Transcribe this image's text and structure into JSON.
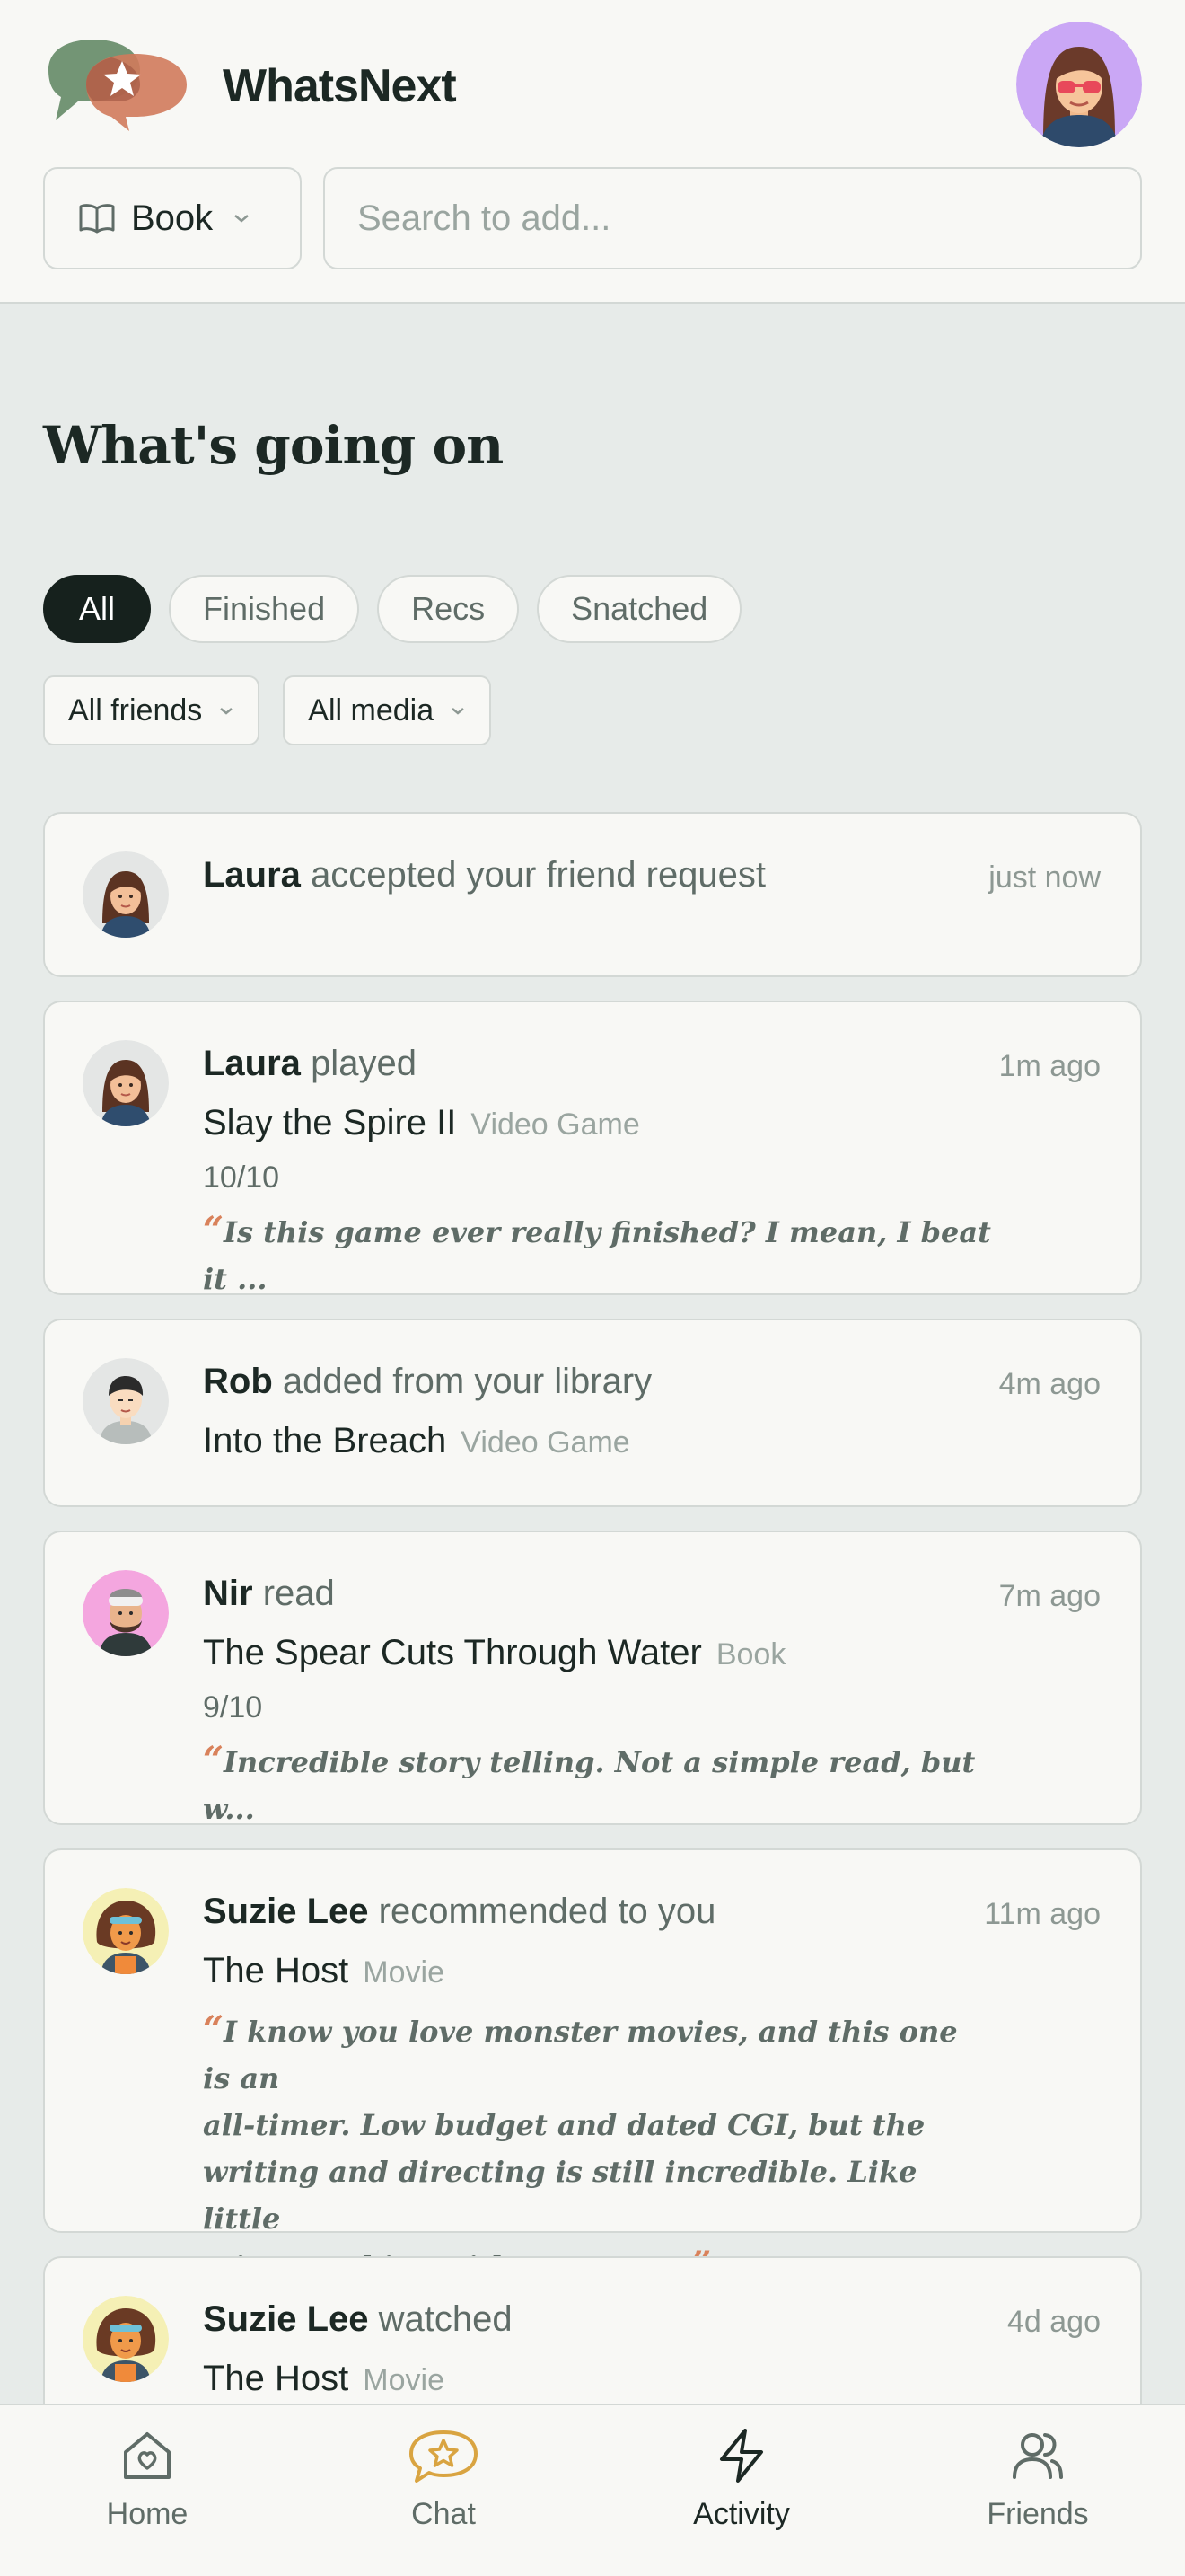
{
  "app": {
    "title": "WhatsNext"
  },
  "toolbar": {
    "media_type": "Book",
    "search_placeholder": "Search to add..."
  },
  "activity": {
    "heading": "What's going on",
    "tabs": [
      "All",
      "Finished",
      "Recs",
      "Snatched"
    ],
    "active_tab": "All",
    "filters": {
      "friends": "All friends",
      "media": "All media"
    }
  },
  "feed": [
    {
      "name": "Laura",
      "action": "accepted your friend request",
      "time": "just now"
    },
    {
      "name": "Laura",
      "action": "played",
      "time": "1m ago",
      "title": "Slay the Spire II",
      "type": "Video Game",
      "rating": "10/10",
      "quote": "Is this game ever really finished? I mean, I beat it ..."
    },
    {
      "name": "Rob",
      "action": "added from your library",
      "time": "4m ago",
      "title": "Into the Breach",
      "type": "Video Game"
    },
    {
      "name": "Nir",
      "action": "read",
      "time": "7m ago",
      "title": "The Spear Cuts Through Water",
      "type": "Book",
      "rating": "9/10",
      "quote": "Incredible story telling. Not a simple read, but w..."
    },
    {
      "name": "Suzie Lee",
      "action": "recommended to you",
      "time": "11m ago",
      "title": "The Host",
      "type": "Movie",
      "quote_lines": [
        "I know you love monster movies, and this one is an",
        "all-timer. Low budget and dated CGI, but the",
        "writing and directing is still incredible. Like little",
        "miss sunshine with a monster."
      ]
    },
    {
      "name": "Suzie Lee",
      "action": "watched",
      "time": "4d ago",
      "title": "The Host",
      "type": "Movie"
    }
  ],
  "nav": [
    {
      "label": "Home",
      "icon": "home-icon"
    },
    {
      "label": "Chat",
      "icon": "chat-star-icon"
    },
    {
      "label": "Activity",
      "icon": "lightning-icon"
    },
    {
      "label": "Friends",
      "icon": "friends-icon"
    }
  ],
  "nav_active": "Activity",
  "colors": {
    "accent": "#d9825b",
    "dark": "#16211d",
    "chat_icon": "#d9a441",
    "background": "#e7ebe9"
  }
}
